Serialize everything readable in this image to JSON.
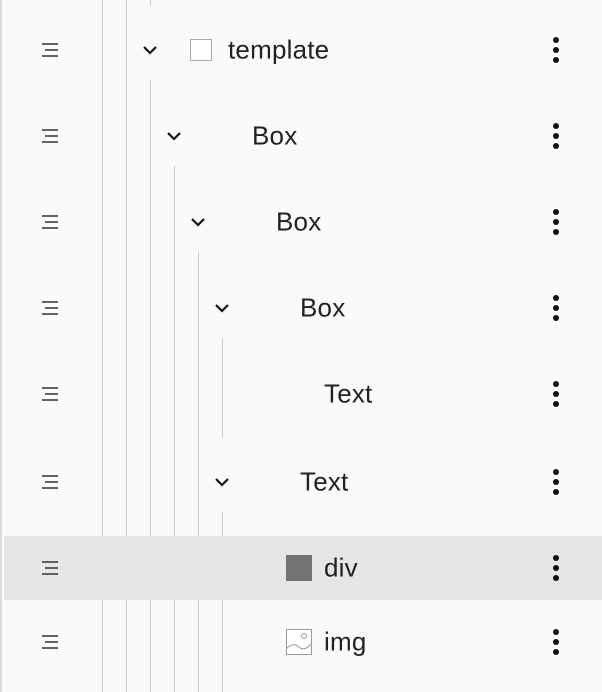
{
  "tree": {
    "rows": [
      {
        "label": "template",
        "expanded": true,
        "icon": "checkbox-icon"
      },
      {
        "label": "Box",
        "expanded": true
      },
      {
        "label": "Box",
        "expanded": true
      },
      {
        "label": "Box",
        "expanded": true
      },
      {
        "label": "Text",
        "expanded": false
      },
      {
        "label": "Text",
        "expanded": true
      },
      {
        "label": "div",
        "icon": "dark-square-icon",
        "selected": true
      },
      {
        "label": "img",
        "icon": "image-icon"
      }
    ]
  },
  "colors": {
    "background": "#fafafa",
    "selected_row": "#e6e6e6",
    "guide_line": "#c9c9c9",
    "text": "#222222",
    "div_swatch": "#737373"
  }
}
